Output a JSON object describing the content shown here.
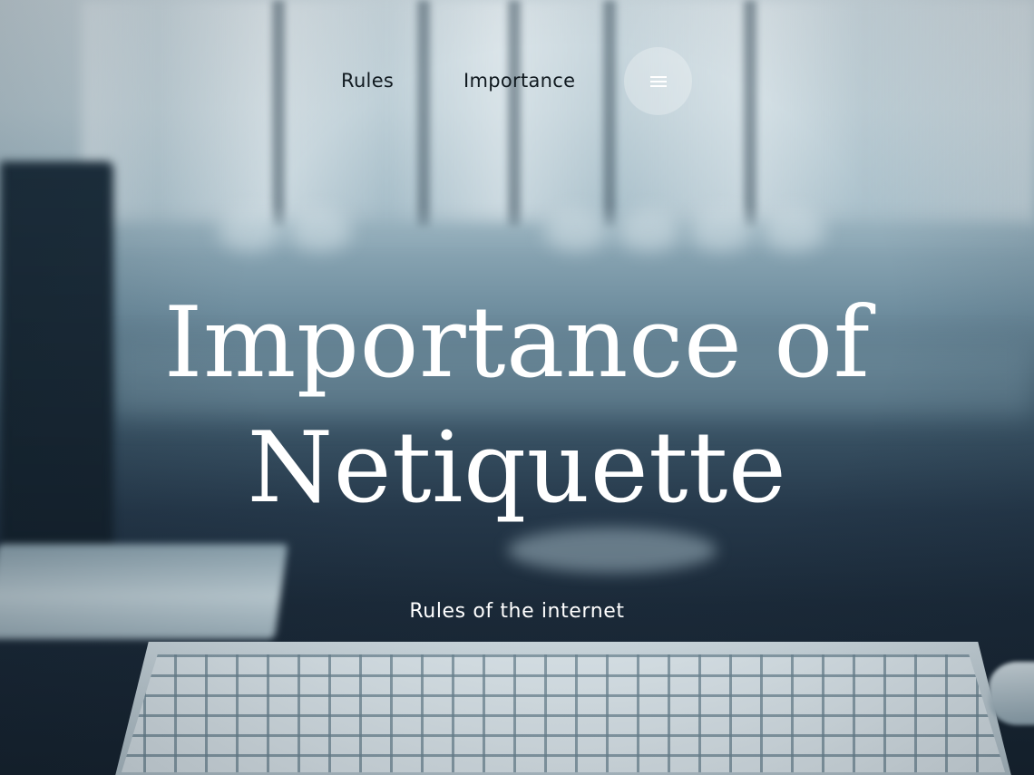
{
  "nav": {
    "links": [
      {
        "label": "Rules"
      },
      {
        "label": "Importance"
      }
    ],
    "menu_icon": "hamburger-menu-icon"
  },
  "hero": {
    "title": "Importance of Netiquette",
    "subtitle": "Rules of the internet",
    "background": "blurred-office-desk-keyboard-photo"
  },
  "colors": {
    "nav_text": "#111a20",
    "hero_text": "#ffffff",
    "menu_button_bg": "rgba(255,255,255,0.28)",
    "background_dark": "#1b2a39",
    "background_light": "#c9d6dc"
  }
}
